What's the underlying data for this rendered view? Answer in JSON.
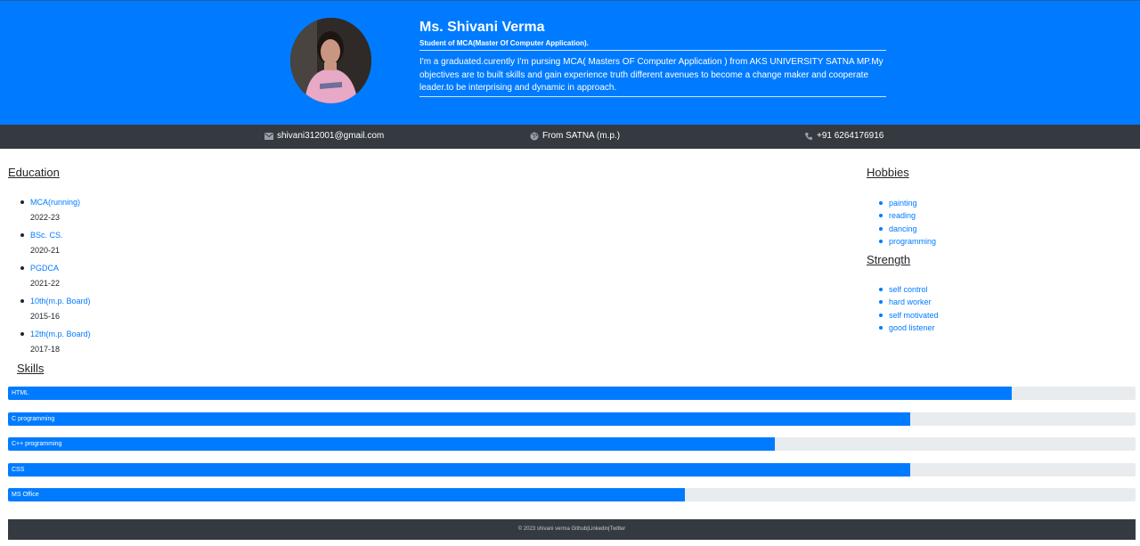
{
  "profile": {
    "name": "Ms. Shivani Verma",
    "role": "Student of MCA(Master Of Computer Application).",
    "bio": "I'm a graduated.curently I'm pursing MCA( Masters OF Computer Application ) from AKS UNIVERSITY SATNA MP.My objectives are to built skills and gain experience truth different avenues to become a change maker and cooperate leader.to be interprising and dynamic in approach."
  },
  "contact": {
    "email": "shivani312001@gmail.com",
    "location": "From SATNA (m.p.)",
    "phone": "+91 6264176916"
  },
  "education": {
    "title": "Education",
    "items": [
      {
        "degree": "MCA(running)",
        "year": "2022-23"
      },
      {
        "degree": "BSc. CS.",
        "year": "2020-21"
      },
      {
        "degree": "PGDCA",
        "year": "2021-22"
      },
      {
        "degree": "10th(m.p. Board)",
        "year": "2015-16"
      },
      {
        "degree": "12th(m.p. Board)",
        "year": "2017-18"
      }
    ]
  },
  "hobbies": {
    "title": "Hobbies",
    "items": [
      "painting",
      "reading",
      "dancing",
      "programming"
    ]
  },
  "strength": {
    "title": "Strength",
    "items": [
      "self control",
      "hard worker",
      "self motivated",
      "good listener"
    ]
  },
  "skills": {
    "title": "Skills",
    "items": [
      {
        "label": "HTML",
        "level_percent": 89
      },
      {
        "label": "C programming",
        "level_percent": 80
      },
      {
        "label": "C++ programming",
        "level_percent": 68
      },
      {
        "label": "CSS",
        "level_percent": 80
      },
      {
        "label": "MS Office",
        "level_percent": 60
      }
    ]
  },
  "footer": {
    "text": "© 2023 shivani verma Github|Linkedin|Twitter"
  },
  "colors": {
    "primary": "#007bff",
    "dark": "#343a40",
    "track": "#e9ecef"
  },
  "icons": {
    "email": "envelope-icon",
    "location": "globe-icon",
    "phone": "phone-icon"
  }
}
